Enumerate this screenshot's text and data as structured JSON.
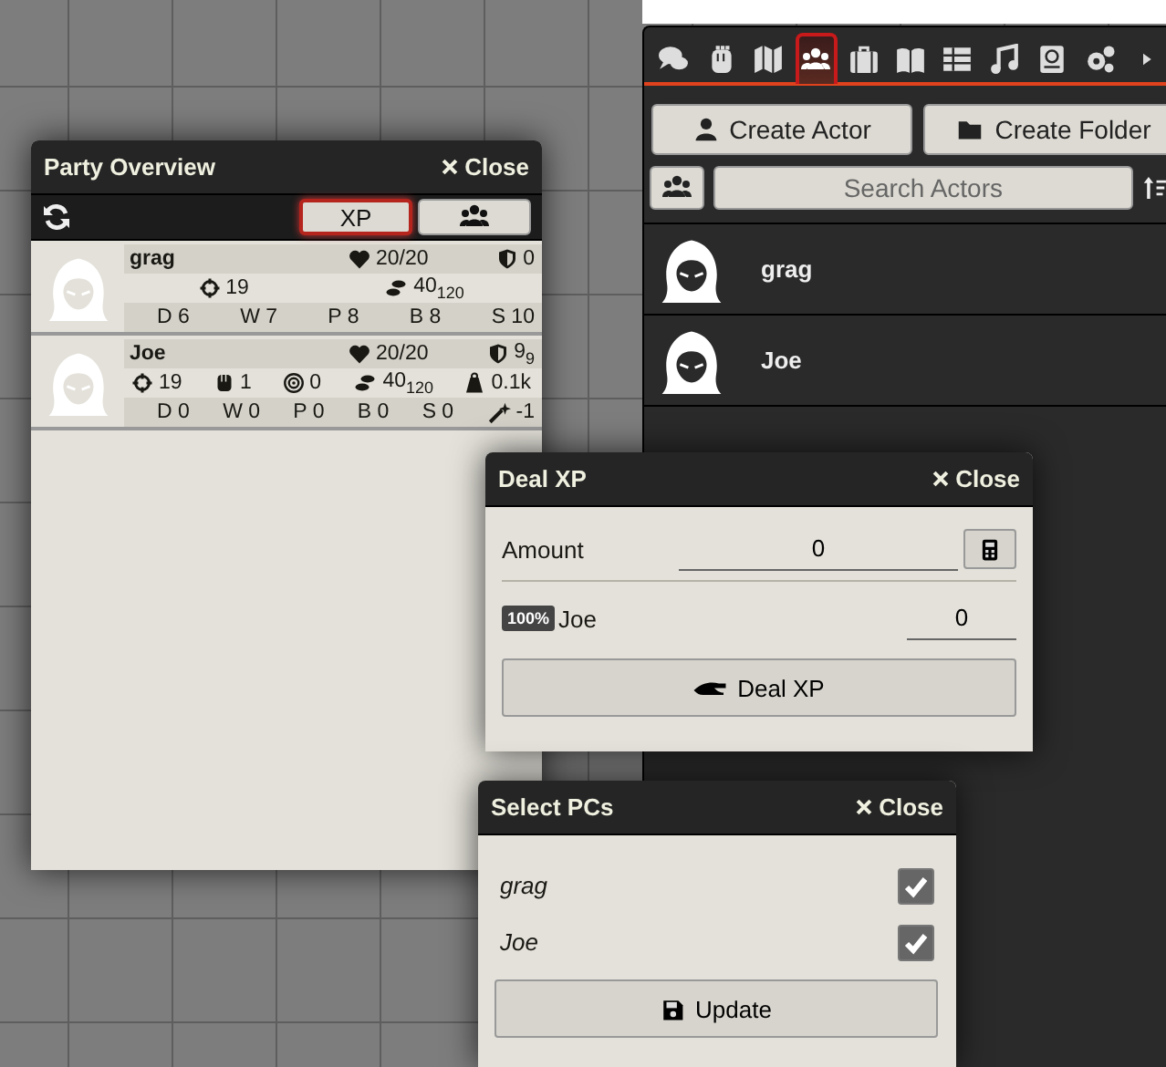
{
  "party_overview": {
    "title": "Party Overview",
    "close_label": "Close",
    "toolbar": [
      {
        "kind": "xp",
        "label": "XP",
        "selected": true
      },
      {
        "kind": "group",
        "selected": false
      }
    ],
    "members": [
      {
        "name": "grag",
        "hp": "20/20",
        "ac": "0",
        "stats": [
          {
            "kind": "initiative",
            "value": "19"
          },
          {
            "kind": "speed",
            "value": "40",
            "sub": "120"
          }
        ],
        "saves": [
          {
            "kind": "save",
            "value": "D 6"
          },
          {
            "kind": "save",
            "value": "W 7"
          },
          {
            "kind": "save",
            "value": "P 8"
          },
          {
            "kind": "save",
            "value": "B 8"
          },
          {
            "kind": "save",
            "value": "S 10"
          }
        ]
      },
      {
        "name": "Joe",
        "hp": "20/20",
        "ac": "9",
        "ac_sub": "9",
        "stats": [
          {
            "kind": "initiative",
            "value": "19"
          },
          {
            "kind": "attack",
            "value": "1"
          },
          {
            "kind": "target",
            "value": "0"
          },
          {
            "kind": "speed",
            "value": "40",
            "sub": "120"
          },
          {
            "kind": "load",
            "value": "0.1k"
          }
        ],
        "saves": [
          {
            "kind": "save",
            "value": "D 0"
          },
          {
            "kind": "save",
            "value": "W 0"
          },
          {
            "kind": "save",
            "value": "P 0"
          },
          {
            "kind": "save",
            "value": "B 0"
          },
          {
            "kind": "save",
            "value": "S 0"
          },
          {
            "kind": "spell",
            "value": "-1"
          }
        ]
      }
    ]
  },
  "sidebar": {
    "tabs": [
      {
        "kind": "chat",
        "selected": false
      },
      {
        "kind": "combat",
        "selected": false
      },
      {
        "kind": "scenes",
        "selected": false
      },
      {
        "kind": "actors",
        "selected": true
      },
      {
        "kind": "items",
        "selected": false
      },
      {
        "kind": "journal",
        "selected": false
      },
      {
        "kind": "tables",
        "selected": false
      },
      {
        "kind": "playlists",
        "selected": false
      },
      {
        "kind": "compendium",
        "selected": false
      },
      {
        "kind": "settings",
        "selected": false
      },
      {
        "kind": "more",
        "selected": false
      }
    ],
    "create_actor": "Create Actor",
    "create_folder": "Create Folder",
    "search_placeholder": "Search Actors",
    "actors": [
      {
        "name": "grag"
      },
      {
        "name": "Joe"
      }
    ]
  },
  "deal_xp": {
    "title": "Deal XP",
    "close_label": "Close",
    "amount_label": "Amount",
    "amount_value": "0",
    "recipients": [
      {
        "share": "100%",
        "name": "Joe",
        "value": "0"
      }
    ],
    "button": "Deal XP"
  },
  "select_pcs": {
    "title": "Select PCs",
    "close_label": "Close",
    "pcs": [
      {
        "name": "grag",
        "checked": true
      },
      {
        "name": "Joe",
        "checked": true
      }
    ],
    "button": "Update"
  }
}
